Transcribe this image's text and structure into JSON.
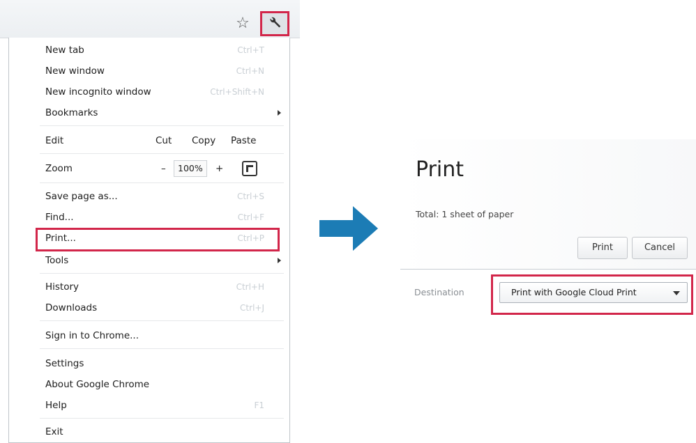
{
  "menu": {
    "items": [
      {
        "label": "New tab",
        "shortcut": "Ctrl+T"
      },
      {
        "label": "New window",
        "shortcut": "Ctrl+N"
      },
      {
        "label": "New incognito window",
        "shortcut": "Ctrl+Shift+N"
      },
      {
        "label": "Bookmarks"
      },
      {
        "label": "Edit"
      },
      {
        "label": "Zoom"
      },
      {
        "label": "Save page as...",
        "shortcut": "Ctrl+S"
      },
      {
        "label": "Find...",
        "shortcut": "Ctrl+F"
      },
      {
        "label": "Print...",
        "shortcut": "Ctrl+P"
      },
      {
        "label": "Tools"
      },
      {
        "label": "History",
        "shortcut": "Ctrl+H"
      },
      {
        "label": "Downloads",
        "shortcut": "Ctrl+J"
      },
      {
        "label": "Sign in to Chrome..."
      },
      {
        "label": "Settings"
      },
      {
        "label": "About Google Chrome"
      },
      {
        "label": "Help",
        "shortcut": "F1"
      },
      {
        "label": "Exit"
      }
    ],
    "edit": {
      "cut": "Cut",
      "copy": "Copy",
      "paste": "Paste"
    },
    "zoom": {
      "minus": "–",
      "value": "100%",
      "plus": "+"
    }
  },
  "toolbar": {
    "star_icon": "star-icon",
    "menu_icon": "wrench-icon"
  },
  "dialog": {
    "title": "Print",
    "total": "Total: 1 sheet of paper",
    "print_label": "Print",
    "cancel_label": "Cancel",
    "destination_label": "Destination",
    "destination_value": "Print with Google Cloud Print"
  },
  "colors": {
    "highlight": "#d2264a",
    "arrow": "#1c7cb5"
  }
}
